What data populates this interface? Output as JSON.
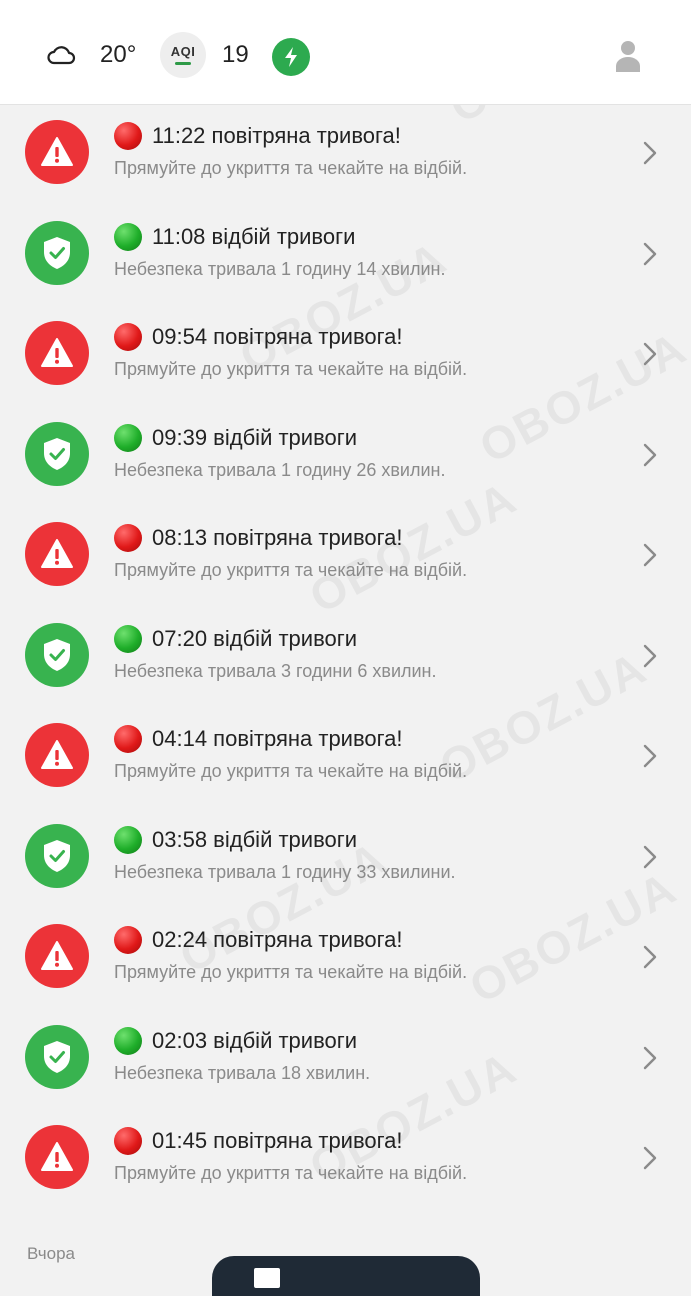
{
  "status": {
    "weather_icon": "cloud-icon",
    "temperature": "20°",
    "aqi_label": "AQI",
    "aqi_value": "19",
    "action_icon": "lightning-icon",
    "profile_icon": "user-icon"
  },
  "colors": {
    "alert": "#ec3338",
    "clear": "#38b34f",
    "muted_text": "#8a8a8a"
  },
  "alerts": [
    {
      "kind": "alert",
      "title": "11:22 повітряна тривога!",
      "subtitle": "Прямуйте до укриття та чекайте на відбій."
    },
    {
      "kind": "clear",
      "title": "11:08 відбій тривоги",
      "subtitle": "Небезпека тривала 1 годину 14 хвилин."
    },
    {
      "kind": "alert",
      "title": "09:54 повітряна тривога!",
      "subtitle": "Прямуйте до укриття та чекайте на відбій."
    },
    {
      "kind": "clear",
      "title": "09:39 відбій тривоги",
      "subtitle": "Небезпека тривала 1 годину 26 хвилин."
    },
    {
      "kind": "alert",
      "title": "08:13 повітряна тривога!",
      "subtitle": "Прямуйте до укриття та чекайте на відбій."
    },
    {
      "kind": "clear",
      "title": "07:20 відбій тривоги",
      "subtitle": "Небезпека тривала 3 години 6 хвилин."
    },
    {
      "kind": "alert",
      "title": "04:14 повітряна тривога!",
      "subtitle": "Прямуйте до укриття та чекайте на відбій."
    },
    {
      "kind": "clear",
      "title": "03:58 відбій тривоги",
      "subtitle": "Небезпека тривала 1 годину 33 хвилини."
    },
    {
      "kind": "alert",
      "title": "02:24 повітряна тривога!",
      "subtitle": "Прямуйте до укриття та чекайте на відбій."
    },
    {
      "kind": "clear",
      "title": "02:03 відбій тривоги",
      "subtitle": "Небезпека тривала 18 хвилин."
    },
    {
      "kind": "alert",
      "title": "01:45 повітряна тривога!",
      "subtitle": "Прямуйте до укриття та чекайте на відбій."
    }
  ],
  "section_label": "Вчора",
  "watermark": "OBOZ.UA"
}
